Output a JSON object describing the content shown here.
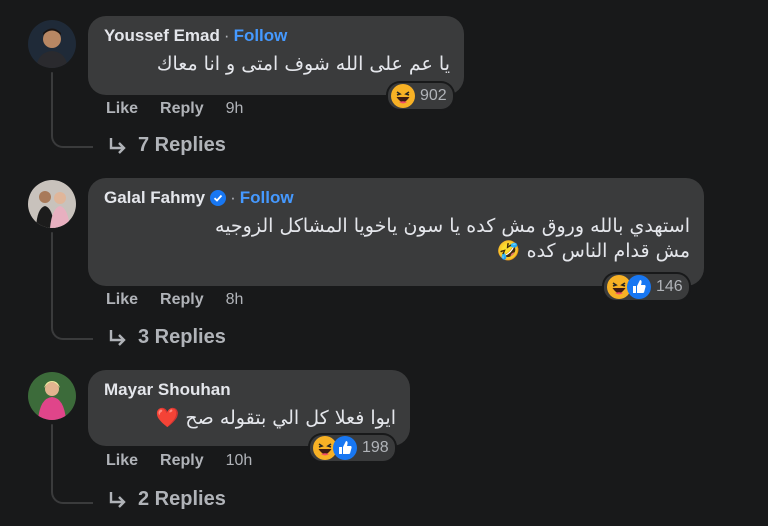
{
  "comments": [
    {
      "author": "Youssef Emad",
      "follow": "Follow",
      "text": "يا عم على الله شوف امتى و انا معاك",
      "text2": "",
      "reaction_count": "902",
      "like": "Like",
      "reply": "Reply",
      "time": "9h",
      "replies": "7 Replies"
    },
    {
      "author": "Galal Fahmy",
      "follow": "Follow",
      "text": "استهدي بالله وروق مش كده يا سون ياخويا المشاكل الزوجيه",
      "text2": "مش قدام الناس كده 🤣",
      "reaction_count": "146",
      "like": "Like",
      "reply": "Reply",
      "time": "8h",
      "replies": "3 Replies"
    },
    {
      "author": "Mayar Shouhan",
      "follow": "",
      "text": "ايوا فعلا كل الي بتقوله صح ❤️",
      "text2": "",
      "reaction_count": "198",
      "like": "Like",
      "reply": "Reply",
      "time": "10h",
      "replies": "2 Replies"
    }
  ],
  "icons": {
    "haha": "haha-icon",
    "like": "like-icon",
    "reply_arrow": "reply-arrow-icon",
    "verified": "verified-badge-icon"
  },
  "colors": {
    "background": "#18191a",
    "bubble": "#3a3b3c",
    "follow": "#4599ff",
    "muted": "#b0b3b8"
  }
}
